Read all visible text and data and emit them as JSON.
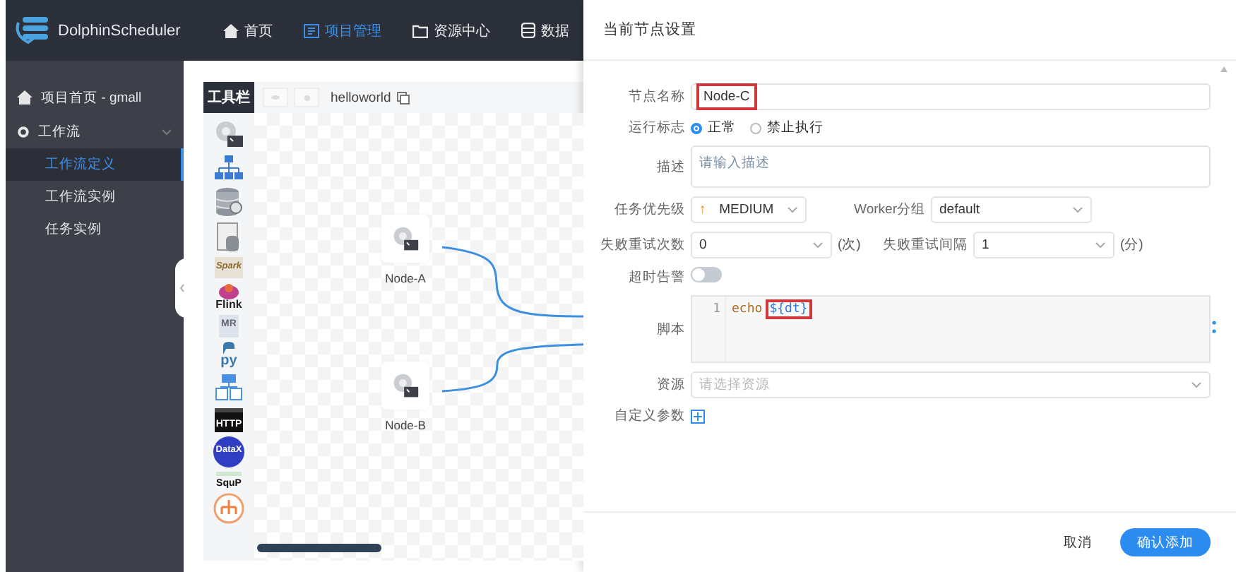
{
  "header": {
    "logo": "DolphinScheduler",
    "nav": [
      {
        "kind": "home",
        "label": "首页",
        "selected": false
      },
      {
        "kind": "project",
        "label": "项目管理",
        "selected": true
      },
      {
        "kind": "folder",
        "label": "资源中心",
        "selected": false
      },
      {
        "kind": "database",
        "label": "数据",
        "selected": false
      }
    ]
  },
  "sidebar": {
    "items": [
      {
        "kind": "home",
        "label": "项目首页 - gmall"
      },
      {
        "kind": "gear",
        "label": "工作流",
        "expanded": true,
        "children": [
          {
            "label": "工作流定义",
            "selected": true
          },
          {
            "label": "工作流实例",
            "selected": false
          },
          {
            "label": "任务实例",
            "selected": false
          }
        ]
      }
    ]
  },
  "canvas": {
    "toolbar_label": "工具栏",
    "process_name": "helloworld",
    "tools": [
      {
        "kind": "shell"
      },
      {
        "kind": "subprocess"
      },
      {
        "kind": "procedure"
      },
      {
        "kind": "sql"
      },
      {
        "kind": "spark",
        "label": "Spark"
      },
      {
        "kind": "flink",
        "label": "Flink"
      },
      {
        "kind": "mr",
        "label": "MR"
      },
      {
        "kind": "python",
        "label": "py"
      },
      {
        "kind": "dependent"
      },
      {
        "kind": "http",
        "label": "HTTP"
      },
      {
        "kind": "datax",
        "label": "DataX"
      },
      {
        "kind": "sqoop",
        "label": "SquP"
      },
      {
        "kind": "conditions"
      }
    ],
    "nodes": [
      {
        "label": "Node-A"
      },
      {
        "label": "Node-B"
      }
    ]
  },
  "panel": {
    "title": "当前节点设置",
    "node_name": {
      "label": "节点名称",
      "value": "Node-C",
      "highlighted": true
    },
    "run_flag": {
      "label": "运行标志",
      "options": [
        {
          "label": "正常",
          "selected": true
        },
        {
          "label": "禁止执行",
          "selected": false
        }
      ]
    },
    "description": {
      "label": "描述",
      "placeholder": "请输入描述"
    },
    "priority": {
      "label": "任务优先级",
      "icon": "↑",
      "value": "MEDIUM"
    },
    "worker_group": {
      "label": "Worker分组",
      "value": "default"
    },
    "retry_times": {
      "label": "失败重试次数",
      "value": "0",
      "unit": "(次)"
    },
    "retry_interval": {
      "label": "失败重试间隔",
      "value": "1",
      "unit": "(分)"
    },
    "timeout_alarm": {
      "label": "超时告警",
      "on": false
    },
    "script": {
      "label": "脚本",
      "lines": [
        {
          "number": "1",
          "tokens": [
            {
              "text": "echo",
              "kind": "keyword",
              "highlighted": false
            },
            {
              "text": "${dt}",
              "kind": "variable",
              "highlighted": true
            }
          ]
        }
      ]
    },
    "resources": {
      "label": "资源",
      "placeholder": "请选择资源"
    },
    "custom_params": {
      "label": "自定义参数"
    },
    "buttons": [
      {
        "kind": "text",
        "label": "取消"
      },
      {
        "kind": "primary",
        "label": "确认添加"
      }
    ]
  }
}
